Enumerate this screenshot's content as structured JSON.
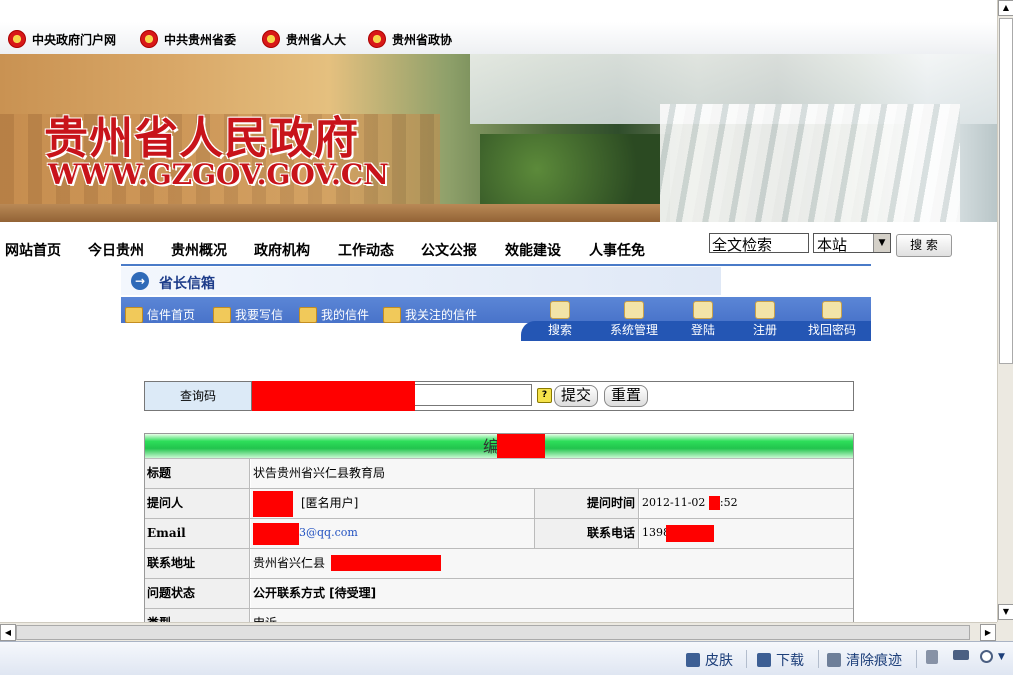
{
  "top_links": [
    {
      "label": "中央政府门户网"
    },
    {
      "label": "中共贵州省委"
    },
    {
      "label": "贵州省人大"
    },
    {
      "label": "贵州省政协"
    }
  ],
  "banner": {
    "title": "贵州省人民政府",
    "url": "WWW.GZGOV.GOV.CN"
  },
  "nav": {
    "items": [
      "网站首页",
      "今日贵州",
      "贵州概况",
      "政府机构",
      "工作动态",
      "公文公报",
      "效能建设",
      "人事任免"
    ],
    "search_value": "全文检索",
    "scope_value": "本站",
    "search_button": "搜 索"
  },
  "mailbox": {
    "title": "省长信箱",
    "tabs": [
      "信件首页",
      "我要写信",
      "我的信件",
      "我关注的信件"
    ],
    "tools": [
      "搜索",
      "系统管理",
      "登陆",
      "注册",
      "找回密码"
    ]
  },
  "query": {
    "label": "查询码",
    "submit": "提交",
    "reset": "重置"
  },
  "detail": {
    "header": "编号",
    "rows": {
      "title_label": "标题",
      "title_value": "状告贵州省兴仁县教育局",
      "asker_label": "提问人",
      "asker_value": "[匿名用户]",
      "time_label": "提问时间",
      "time_value_a": "2012-11-02",
      "time_value_b": ":52",
      "email_label": "Email",
      "email_value": "3@qq.com",
      "phone_label": "联系电话",
      "phone_value": "1398",
      "address_label": "联系地址",
      "address_value": "贵州省兴仁县",
      "status_label": "问题状态",
      "status_value": "公开联系方式  [待受理]",
      "type_label": "类型",
      "type_value": "申诉"
    }
  },
  "statusbar": {
    "skin": "皮肤",
    "download": "下载",
    "clear": "清除痕迹"
  },
  "colors": {
    "title_red": "#c8131a",
    "nav_blue": "#3c66c1",
    "redaction": "#ff0000",
    "detail_header_green": "#22c44d"
  }
}
